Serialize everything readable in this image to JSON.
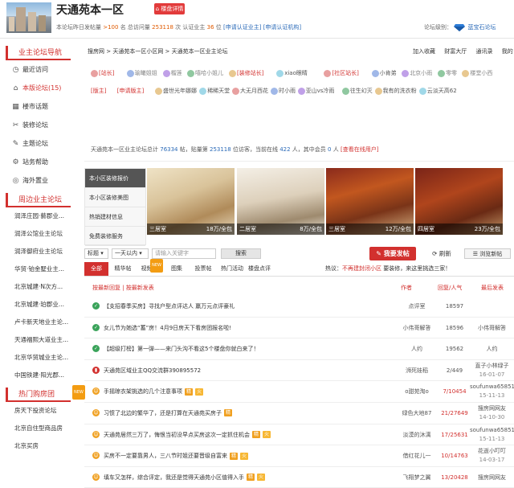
{
  "header": {
    "site_title": "天通苑本一区",
    "detail_button": "楼盘详情",
    "stats_text_1": "本论坛昨日发帖量",
    "stats_yesterday": ">100",
    "stats_text_2": "名  总访问量",
    "stats_visits": "253118",
    "stats_text_3": "次  认证业主",
    "stats_owners": "36",
    "stats_text_4": "位",
    "apply_owner": "[申请认证业主]",
    "apply_org": "[申请认证机构]",
    "level_label": "论坛级别：",
    "level_value": "蓝宝石论坛"
  },
  "sidebar": {
    "section1": "业主论坛导航",
    "items": [
      {
        "label": "最近访问",
        "icon": "clock-icon",
        "glyph": "◷"
      },
      {
        "label": "本版论坛(15)",
        "icon": "home-icon",
        "glyph": "⌂"
      },
      {
        "label": "楼市话题",
        "icon": "building-icon",
        "glyph": "▦"
      },
      {
        "label": "装修论坛",
        "icon": "tools-icon",
        "glyph": "✂"
      },
      {
        "label": "主题论坛",
        "icon": "edit-icon",
        "glyph": "✎"
      },
      {
        "label": "站务帮助",
        "icon": "help-icon",
        "glyph": "⚙"
      },
      {
        "label": "海外置业",
        "icon": "globe-icon",
        "glyph": "◎"
      }
    ],
    "section2": "周边业主论坛",
    "nearby": [
      "润泽庄园·藝郡业...",
      "润泽公馆业主论坛",
      "润泽御府业主论坛",
      "华贸·铂金墅业主...",
      "北京城建·N次方...",
      "北京城建·珀郡业...",
      "卢卡新天地业主论...",
      "天通福熙大道业主...",
      "北京华贸城业主论...",
      "中国铁建·阳光郡..."
    ],
    "section3": "热门购房团",
    "section3_badge": "NEW",
    "hot": [
      "房天下投资论坛",
      "北京自住型商品房",
      "北京买房"
    ]
  },
  "main": {
    "breadcrumb": [
      "搜房网",
      "天通苑本一区小区网",
      "天通苑本一区业主论坛"
    ],
    "toplinks": [
      "加入收藏",
      "财富大厅",
      "通讯录",
      "我的"
    ],
    "mods_row1": [
      {
        "name": "[站长]",
        "color": "#d2302e"
      },
      {
        "name": "瑜曦姐姐",
        "color": "#888"
      },
      {
        "name": "榴莲",
        "color": "#888"
      },
      {
        "name": "嘻哈小姐儿",
        "color": "#888"
      },
      {
        "name": "[装修站长]",
        "color": "#d2302e"
      },
      {
        "name": "xiao眼睛",
        "color": "#555"
      },
      {
        "name": "[社区站长]",
        "color": "#d2302e"
      },
      {
        "name": "小肯弟",
        "color": "#555"
      },
      {
        "name": "北京小雨",
        "color": "#888"
      },
      {
        "name": "零零",
        "color": "#888"
      },
      {
        "name": "楼堂小西",
        "color": "#888"
      }
    ],
    "mods_row2": [
      "[版主]",
      "[申请版主]",
      "盛世光年娜娜",
      "稀稀天堂",
      "大无月西花",
      "时小雨",
      "亚山vs冷雨",
      "往生幻灭",
      "我有的洗衣粉",
      "云淡天高62"
    ],
    "stats_prefix": "天通苑本一区业主论坛总计",
    "stats_posts": "76334",
    "stats_mid": "帖，贴量第",
    "stats_rank": "253118",
    "stats_mid2": "位访客，当前在线",
    "stats_online": "422",
    "stats_mid3": "人，其中会员",
    "stats_members": "0",
    "stats_suffix": "人",
    "stats_link": "[查看在线用户]"
  },
  "deco": {
    "items": [
      "本小区装修报价",
      "本小区装修美图",
      "热销建材信息",
      "免费装修服务"
    ]
  },
  "photos": [
    {
      "room": "三居室",
      "price": "18万/全包"
    },
    {
      "room": "二居室",
      "price": "8万/全包"
    },
    {
      "room": "三居室",
      "price": "12万/全包"
    },
    {
      "room": "四居室",
      "price": "23万/全包"
    }
  ],
  "toolbar": {
    "select1": "标题",
    "select2": "一天以内",
    "search_placeholder": "请输入关键字",
    "search_button": "搜索",
    "post_button": "我要发帖",
    "refresh": "刷新",
    "browse": "浏览新帖"
  },
  "tabs": [
    "全部",
    "精华帖",
    "视频贴",
    "图集",
    "投票帖",
    "热门活动",
    "楼盘点评"
  ],
  "tab_badge": "NEW",
  "hint_prefix": "热议：",
  "hint_red": "不再建封闭小区",
  "hint_suffix": "要装修，来这里挑选三家！",
  "sort_label": "按最新回复 | 按最新发表",
  "columns": {
    "author": "作者",
    "reply": "回复/人气",
    "last": "最后发表"
  },
  "posts": [
    {
      "icon": "pin-icon",
      "icolor": "#3aa35a",
      "title": "【支招春季买房】寻找户型点评达人 赢万元点评豪礼",
      "tags": [],
      "author": "点评室",
      "count": "18597",
      "cred": false,
      "last_user": "",
      "last_date": ""
    },
    {
      "icon": "pin-icon",
      "icolor": "#3aa35a",
      "title": "女儿节为她选“蓄”房！4月9日房天下看房团报名啦!",
      "tags": [],
      "author": "小伟哥解答",
      "count": "18596",
      "cred": false,
      "last_user": "小伟哥解答",
      "last_date": ""
    },
    {
      "icon": "pin-icon",
      "icolor": "#3aa35a",
      "title": "【超级打榜】第一弹——来门头沟不看这5个楼盘你就白来了！",
      "tags": [],
      "author": "人约",
      "count": "19562",
      "cred": false,
      "last_user": "人约",
      "last_date": ""
    },
    {
      "icon": "bookmark-icon",
      "icolor": "#d2302e",
      "title": "天通苑区域业主QQ交流群390895572",
      "tags": [],
      "author": "浉死娃稻",
      "count": "2/449",
      "cred": false,
      "last_user": "直子小林绿子",
      "last_date": "16-01-07"
    },
    {
      "icon": "smile-icon",
      "icolor": "#f0a020",
      "title": "手摇晾衣架挑选的几个注意事项",
      "tags": [
        "精",
        "火"
      ],
      "author": "o甜苑淘o",
      "count": "7/10454",
      "cred": true,
      "last_user": "soufunwa65851",
      "last_date": "15-11-13"
    },
    {
      "icon": "smile-icon",
      "icolor": "#f0a020",
      "title": "习惯了北边的繁华了，还是打算在天通苑买房子",
      "tags": [
        "精"
      ],
      "author": "绿色大地87",
      "count": "21/27649",
      "cred": true,
      "last_user": "搜房网网友",
      "last_date": "14-10-30"
    },
    {
      "icon": "smile-icon",
      "icolor": "#f0a020",
      "title": "天通苑居然三万了，悔恨当初没早点买房这次一定抓住机会",
      "tags": [
        "精",
        "火"
      ],
      "author": "淡漠的沐漓",
      "count": "17/25631",
      "cred": true,
      "last_user": "soufunwa65851",
      "last_date": "15-11-13"
    },
    {
      "icon": "smile-icon",
      "icolor": "#f0a020",
      "title": "买房不一定要靠男人，三八节时姐还要晋级自富来",
      "tags": [
        "精",
        "火"
      ],
      "author": "借红花儿一",
      "count": "10/14763",
      "cred": true,
      "last_user": "花逝小叮叮",
      "last_date": "14-03-17"
    },
    {
      "icon": "smile-icon",
      "icolor": "#f0a020",
      "title": "填车又怎样，综合评定，我还是觉得天通苑小区值得入手",
      "tags": [
        "精",
        "火"
      ],
      "author": "飞翔梦之翼",
      "count": "13/20428",
      "cred": true,
      "last_user": "搜房网网友",
      "last_date": ""
    }
  ]
}
